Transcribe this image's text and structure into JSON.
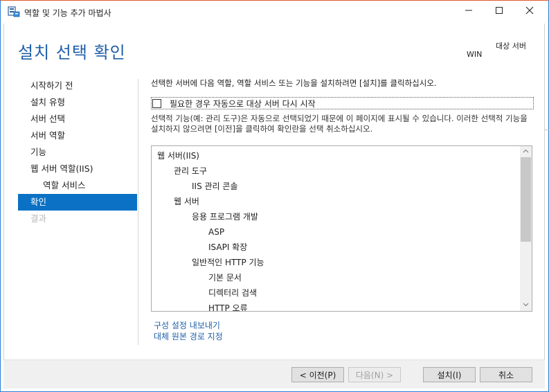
{
  "window": {
    "title": "역할 및 기능 추가 마법사",
    "icon": "server-manager-icon"
  },
  "header": {
    "page_title": "설치 선택 확인",
    "destination_label": "대상 서버",
    "destination_value": "WIN"
  },
  "nav": {
    "items": [
      {
        "label": "시작하기 전",
        "state": "normal"
      },
      {
        "label": "설치 유형",
        "state": "normal"
      },
      {
        "label": "서버 선택",
        "state": "normal"
      },
      {
        "label": "서버 역할",
        "state": "normal"
      },
      {
        "label": "기능",
        "state": "normal"
      },
      {
        "label": "웹 서버 역할(IIS)",
        "state": "normal"
      },
      {
        "label": "역할 서비스",
        "state": "normal"
      },
      {
        "label": "확인",
        "state": "active"
      },
      {
        "label": "결과",
        "state": "disabled"
      }
    ]
  },
  "main": {
    "intro": "선택한 서버에 다음 역할, 역할 서비스 또는 기능을 설치하려면 [설치]를 클릭하십시오.",
    "restart_checkbox_label": "필요한 경우 자동으로 대상 서버 다시 시작",
    "restart_checked": false,
    "note": "선택적 기능(예: 관리 도구)은 자동으로 선택되었기 때문에 이 페이지에 표시될 수 있습니다. 이러한 선택적 기능을 설치하지 않으려면 [이전]을 클릭하여 확인란을 선택 취소하십시오.",
    "selection_list": [
      {
        "label": "웹 서버(IIS)",
        "level": 0
      },
      {
        "label": "관리 도구",
        "level": 1
      },
      {
        "label": "IIS 관리 콘솔",
        "level": 2
      },
      {
        "label": "웹 서버",
        "level": 1
      },
      {
        "label": "응용 프로그램 개발",
        "level": 2
      },
      {
        "label": "ASP",
        "level": 3
      },
      {
        "label": "ISAPI 확장",
        "level": 3
      },
      {
        "label": "일반적인 HTTP 기능",
        "level": 2
      },
      {
        "label": "기본 문서",
        "level": 3
      },
      {
        "label": "디렉터리 검색",
        "level": 3
      },
      {
        "label": "HTTP 오류",
        "level": 3
      }
    ],
    "links": {
      "export": "구성 설정 내보내기",
      "alternate_source": "대체 원본 경로 지정"
    }
  },
  "footer": {
    "prev": "< 이전(P)",
    "next": "다음(N) >",
    "install": "설치(I)",
    "cancel": "취소"
  },
  "colors": {
    "accent": "#0a71c5",
    "title": "#1f5fa8",
    "window_border_top": "#e05a2a"
  }
}
